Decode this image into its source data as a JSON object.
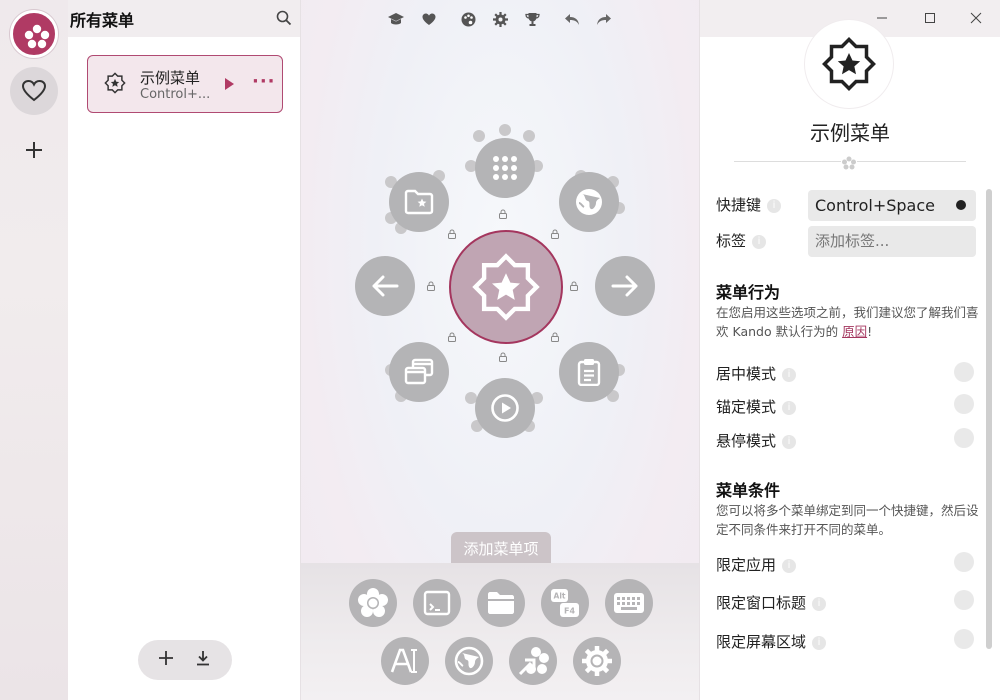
{
  "app": {
    "accent": "#b03a64"
  },
  "rail": {
    "logo_icon": "flower-icon",
    "favorites_icon": "heart-icon",
    "add_icon": "plus-icon"
  },
  "menus_panel": {
    "title": "所有菜单",
    "search_icon": "search-icon",
    "menu": {
      "name": "示例菜单",
      "shortcut": "Control+...",
      "more_label": "···"
    },
    "bottom_actions": [
      "plus-icon",
      "download-icon"
    ]
  },
  "toolbar": {
    "icons": [
      "graduation-cap-icon",
      "heart-icon",
      "palette-icon",
      "gear-icon",
      "trophy-icon",
      "undo-icon",
      "redo-icon"
    ]
  },
  "pie": {
    "center_icon": "star-badge-icon",
    "items": [
      "grid-icon",
      "globe-icon",
      "arrow-right-icon",
      "clipboard-icon",
      "play-icon",
      "windows-icon",
      "arrow-left-icon",
      "folder-star-icon"
    ]
  },
  "tray": {
    "label": "添加菜单项",
    "row1": [
      "submenu-icon",
      "terminal-icon",
      "folder-icon",
      "hotkey-icon",
      "keyboard-icon"
    ],
    "row2": [
      "text-icon",
      "uri-icon",
      "redirect-icon",
      "settings-icon"
    ],
    "hotkey_top": "Alt",
    "hotkey_bottom": "F4"
  },
  "window_controls": [
    "minimize-icon",
    "maximize-icon",
    "close-icon"
  ],
  "properties": {
    "menu_name": "示例菜单",
    "shortcut_label": "快捷键",
    "shortcut_value": "Control+Space",
    "tags_label": "标签",
    "tags_placeholder": "添加标签...",
    "behavior_title": "菜单行为",
    "behavior_desc_1": "在您启用这些选项之前，我们建议您了解我们喜欢 Kando 默认行为的 ",
    "behavior_link": "原因",
    "behavior_desc_2": "!",
    "centered_mode": "居中模式",
    "anchored_mode": "锚定模式",
    "hover_mode": "悬停模式",
    "conditions_title": "菜单条件",
    "conditions_desc": "您可以将多个菜单绑定到同一个快捷键，然后设定不同条件来打开不同的菜单。",
    "limit_app": "限定应用",
    "limit_window_title": "限定窗口标题",
    "limit_screen_area": "限定屏幕区域",
    "info_glyph": "i"
  }
}
